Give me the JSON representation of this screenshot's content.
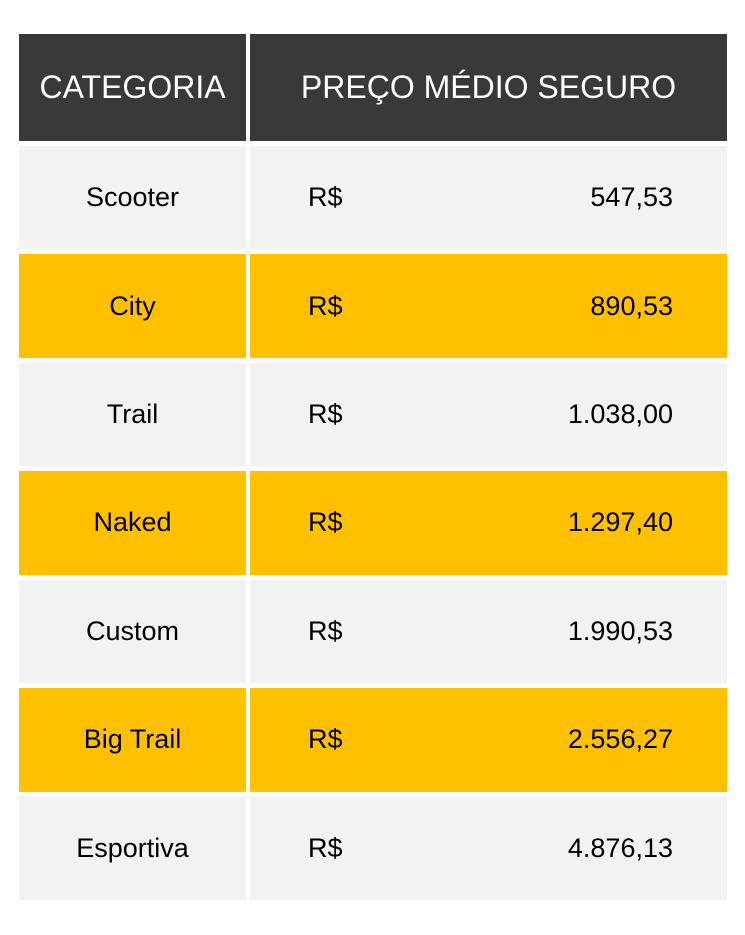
{
  "table": {
    "columns": [
      {
        "key": "categoria",
        "label": "CATEGORIA"
      },
      {
        "key": "preco",
        "label": "PREÇO MÉDIO SEGURO"
      }
    ],
    "currency_symbol": "R$",
    "rows": [
      {
        "categoria": "Scooter",
        "currency": "R$",
        "amount": "547,53",
        "style": "light"
      },
      {
        "categoria": "City",
        "currency": "R$",
        "amount": "890,53",
        "style": "accent"
      },
      {
        "categoria": "Trail",
        "currency": "R$",
        "amount": "1.038,00",
        "style": "light"
      },
      {
        "categoria": "Naked",
        "currency": "R$",
        "amount": "1.297,40",
        "style": "accent"
      },
      {
        "categoria": "Custom",
        "currency": "R$",
        "amount": "1.990,53",
        "style": "light"
      },
      {
        "categoria": "Big Trail",
        "currency": "R$",
        "amount": "2.556,27",
        "style": "accent"
      },
      {
        "categoria": "Esportiva",
        "currency": "R$",
        "amount": "4.876,13",
        "style": "light"
      }
    ]
  },
  "colors": {
    "header_background": "#3B3838",
    "header_text": "#FFFFFF",
    "row_light": "#F2F2F2",
    "row_accent": "#FFC000",
    "body_text": "#000000",
    "page_background": "#FFFFFF",
    "divider": "#FFFFFF"
  }
}
